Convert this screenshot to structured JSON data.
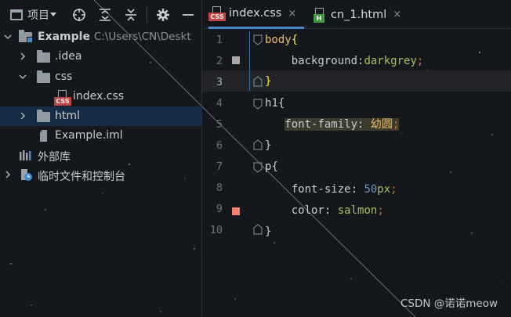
{
  "project_panel": {
    "toolbar": {
      "view_label": "项目",
      "icons": [
        "window-icon",
        "crosshair-icon",
        "expand-all-icon",
        "collapse-all-icon",
        "gear-icon",
        "minimize-icon"
      ]
    },
    "tree": [
      {
        "id": "root",
        "label": "Example",
        "path": "C:\\Users\\CN\\Deskt",
        "icon": "module-folder-icon",
        "expanded": true
      },
      {
        "id": "idea",
        "label": ".idea",
        "icon": "folder-icon",
        "expanded": false
      },
      {
        "id": "css",
        "label": "css",
        "icon": "folder-icon",
        "expanded": true
      },
      {
        "id": "index-css",
        "label": "index.css",
        "icon": "css-file-icon",
        "badge": "CSS"
      },
      {
        "id": "html",
        "label": "html",
        "icon": "folder-icon",
        "expanded": false,
        "selected": true
      },
      {
        "id": "example-iml",
        "label": "Example.iml",
        "icon": "iml-file-icon"
      },
      {
        "id": "ext-libs",
        "label": "外部库",
        "icon": "library-icon"
      },
      {
        "id": "scratches",
        "label": "临时文件和控制台",
        "icon": "scratch-icon",
        "expanded": false
      }
    ]
  },
  "editor": {
    "tabs": [
      {
        "label": "index.css",
        "badge": "CSS",
        "active": true,
        "close": "×"
      },
      {
        "label": "cn_1.html",
        "badge": "H",
        "active": false,
        "close": "×"
      }
    ],
    "current_line": 3,
    "line_numbers": [
      "1",
      "2",
      "3",
      "4",
      "5",
      "6",
      "7",
      "8",
      "9",
      "10"
    ],
    "swatches": [
      {
        "line": 2,
        "color": "#a9a9a9"
      },
      {
        "line": 9,
        "color": "#fa8072"
      }
    ],
    "code": {
      "l1": {
        "selector": "body",
        "brace": "{"
      },
      "l2": {
        "prop": "background",
        "colon": ":",
        "value": "darkgrey",
        "semi": ";"
      },
      "l3": {
        "brace": "}"
      },
      "l4": {
        "selector": "h1",
        "brace": "{"
      },
      "l5": {
        "prop": "font-family",
        "colon": ": ",
        "value": "幼圆",
        "semi": ";"
      },
      "l6": {
        "brace": "}"
      },
      "l7": {
        "selector": "p",
        "brace": "{"
      },
      "l8": {
        "prop": "font-size",
        "colon": ": ",
        "num": "50",
        "unit": "px",
        "semi": ";"
      },
      "l9": {
        "prop": "color",
        "colon": ": ",
        "value": "salmon",
        "semi": ";"
      },
      "l10": {
        "brace": "}"
      }
    }
  },
  "watermark": "CSDN @诺诺meow",
  "colors": {
    "accent": "#4a88c7",
    "css_badge": "#c24545",
    "html_badge": "#3f9a3f",
    "bg": "#14171c"
  }
}
